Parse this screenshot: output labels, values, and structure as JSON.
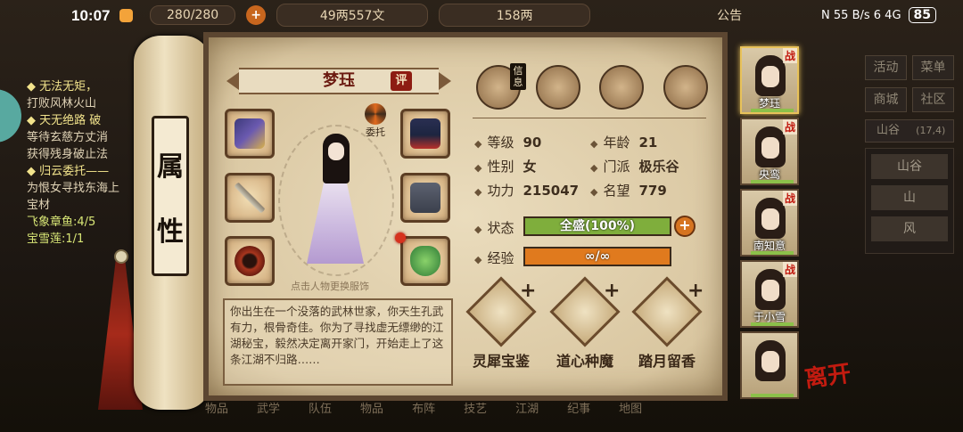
{
  "status_bar": {
    "time": "10:07",
    "signal": "N 55 B/s 6 4G",
    "battery": "85"
  },
  "top_bar": {
    "capacity": "280/280",
    "money": "49两557文",
    "silver": "158两",
    "notice": "公告"
  },
  "quest_log": [
    {
      "text": "◆ 无法无矩，",
      "cls": "h"
    },
    {
      "text": "打败风林火山",
      "cls": ""
    },
    {
      "text": "◆ 天无绝路 破",
      "cls": "h"
    },
    {
      "text": "等待玄慈方丈消",
      "cls": ""
    },
    {
      "text": "获得残身破止法",
      "cls": ""
    },
    {
      "text": "◆ 归云委托——",
      "cls": "h"
    },
    {
      "text": "为恨女寻找东海上",
      "cls": ""
    },
    {
      "text": "宝材",
      "cls": ""
    },
    {
      "text": "飞象章鱼:4/5",
      "cls": "g"
    },
    {
      "text": "宝雪莲:1/1",
      "cls": "g"
    }
  ],
  "right_menu": {
    "activity": "活动",
    "menu": "菜单",
    "shop": "商城",
    "community": "社区",
    "location": "山谷",
    "coords": "(17,4)",
    "maps": [
      "山谷",
      "山",
      "风"
    ]
  },
  "bottom_nav": [
    "物品",
    "武学",
    "队伍",
    "物品",
    "布阵",
    "技艺",
    "江湖",
    "纪事",
    "地图"
  ],
  "scroll": {
    "title_char_1": "属",
    "title_char_2": "性"
  },
  "character": {
    "name": "梦珏",
    "rate_label": "评",
    "entrust_label": "委托",
    "hint": "点击人物更换服饰",
    "bio": "你出生在一个没落的武林世家，你天生孔武有力，根骨奇佳。你为了寻找虚无缥缈的江湖秘宝，毅然决定离开家门，开始走上了这条江湖不归路……"
  },
  "tabs": [
    {
      "name": "info",
      "label": "信息",
      "icon": "hat-icon"
    },
    {
      "name": "scroll",
      "label": "",
      "icon": "scroll-map-icon"
    },
    {
      "name": "bagua",
      "label": "",
      "icon": "bagua-icon"
    },
    {
      "name": "meridian",
      "label": "",
      "icon": "body-meridian-icon"
    }
  ],
  "stats": {
    "level_label": "等级",
    "level": "90",
    "age_label": "年龄",
    "age": "21",
    "gender_label": "性别",
    "gender": "女",
    "sect_label": "门派",
    "sect": "极乐谷",
    "power_label": "功力",
    "power": "215047",
    "fame_label": "名望",
    "fame": "779",
    "state_label": "状态",
    "state": "全盛(100%)",
    "state_fraction": 1.0,
    "exp_label": "经验",
    "exp": "∞/∞",
    "exp_fraction": 1.0
  },
  "skills": [
    {
      "name": "灵犀宝鉴",
      "icon": "book-icon"
    },
    {
      "name": "道心种魔",
      "icon": "scroll-icon"
    },
    {
      "name": "踏月留香",
      "icon": "scroll-icon"
    }
  ],
  "party": [
    {
      "name": "梦珏",
      "tag": "战",
      "active": true
    },
    {
      "name": "央鸾",
      "tag": "战",
      "active": false
    },
    {
      "name": "南知意",
      "tag": "战",
      "active": false
    },
    {
      "name": "于小雪",
      "tag": "战",
      "active": false
    },
    {
      "name": "",
      "tag": "",
      "active": false
    }
  ],
  "leave_label": "离开",
  "colors": {
    "state_bar": "#7fae3c",
    "exp_bar": "#e07a1e",
    "accent_red": "#c21b10"
  }
}
